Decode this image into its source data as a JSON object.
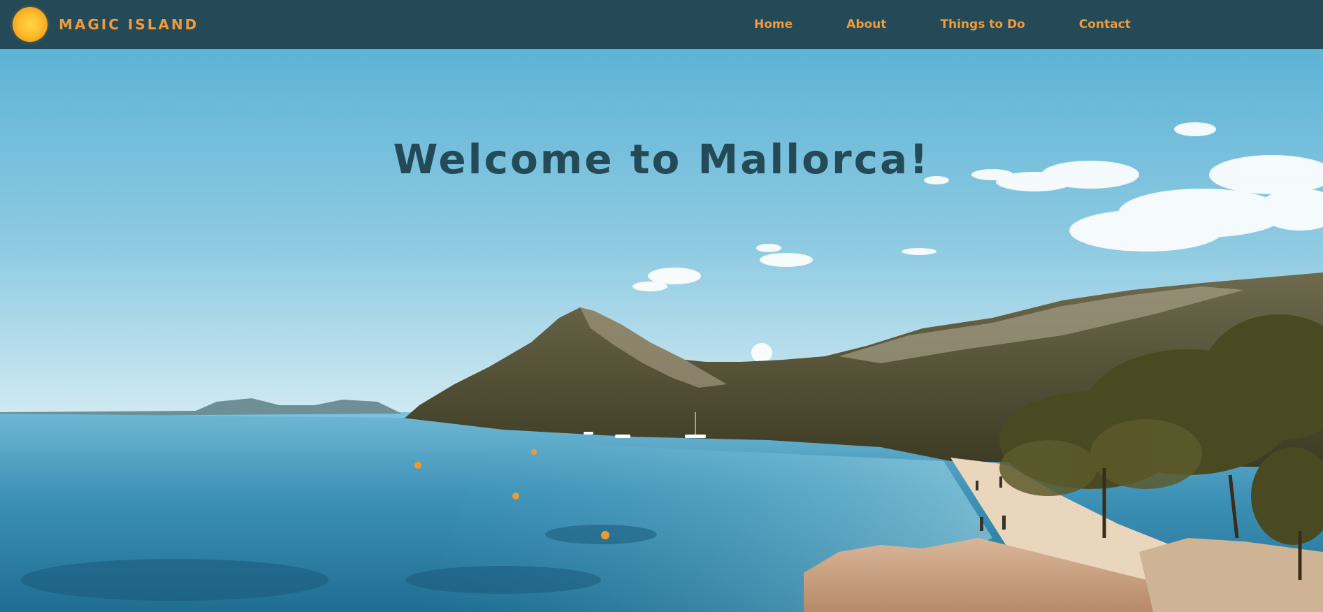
{
  "brand": {
    "name": "MAGIC ISLAND",
    "logo_icon": "sun-icon"
  },
  "nav": {
    "items": [
      {
        "label": "Home"
      },
      {
        "label": "About"
      },
      {
        "label": "Things to Do"
      },
      {
        "label": "Contact"
      }
    ]
  },
  "hero": {
    "title": "Welcome to Mallorca!",
    "image": "beach-landscape-photo"
  },
  "colors": {
    "navbar_bg": "#234a56",
    "accent": "#ef9a3c",
    "title_text": "#234a56"
  }
}
